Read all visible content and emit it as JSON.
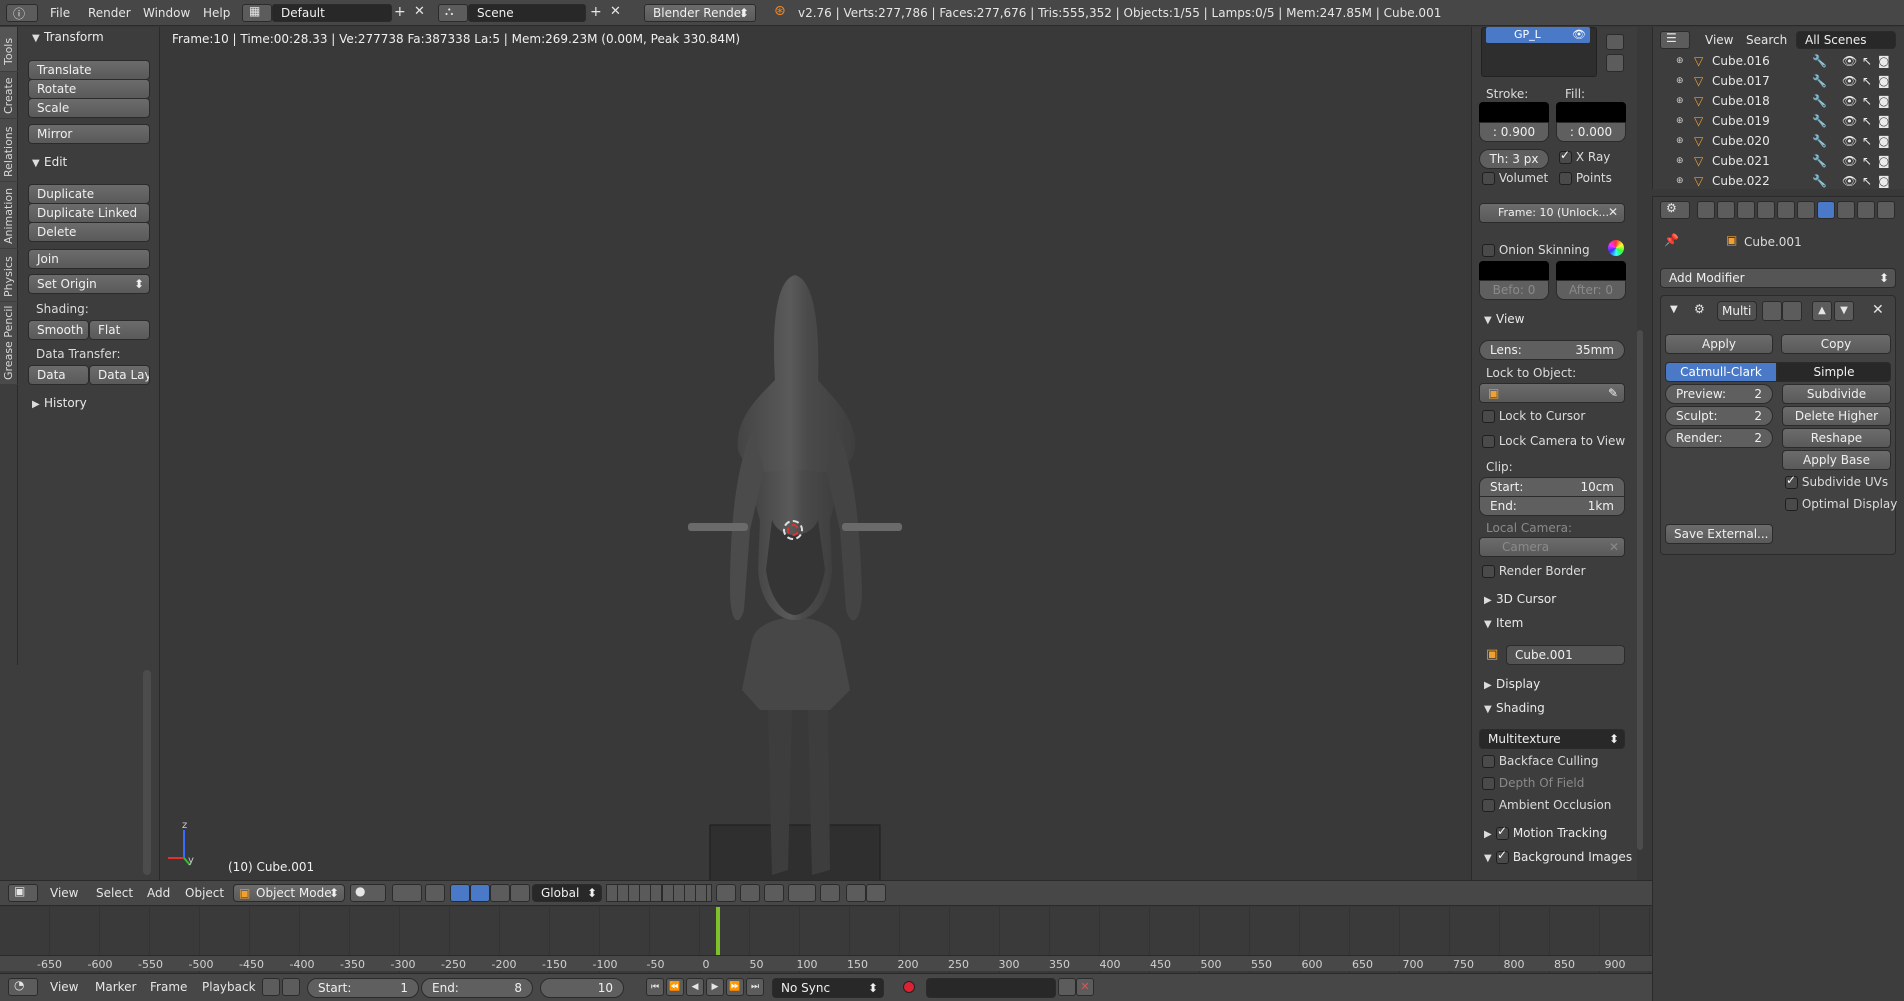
{
  "topbar": {
    "menus": [
      "File",
      "Render",
      "Window",
      "Help"
    ],
    "layout": "Default",
    "scene": "Scene",
    "engine": "Blender Render",
    "stats": "v2.76 | Verts:277,786 | Faces:277,676 | Tris:555,352 | Objects:1/55 | Lamps:0/5 | Mem:247.85M | Cube.001"
  },
  "tool_tabs": [
    "Tools",
    "Create",
    "Relations",
    "Animation",
    "Physics",
    "Grease Pencil"
  ],
  "tools": {
    "transform_header": "Transform",
    "transform": [
      "Translate",
      "Rotate",
      "Scale"
    ],
    "mirror": "Mirror",
    "edit_header": "Edit",
    "edit": [
      "Duplicate",
      "Duplicate Linked",
      "Delete"
    ],
    "join": "Join",
    "set_origin": "Set Origin",
    "shading_label": "Shading:",
    "smooth": "Smooth",
    "flat": "Flat",
    "data_transfer_label": "Data Transfer:",
    "data": "Data",
    "data_layout": "Data Layo",
    "history_header": "History"
  },
  "viewport": {
    "info": "Frame:10 | Time:00:28.33 | Ve:277738 Fa:387338 La:5 | Mem:269.23M (0.00M, Peak 330.84M)",
    "object_label": "(10) Cube.001",
    "axis_z": "z",
    "axis_y": "y"
  },
  "properties_panel": {
    "layer": "GP_L",
    "stroke_label": "Stroke:",
    "fill_label": "Fill:",
    "stroke_value": ": 0.900",
    "fill_value": ": 0.000",
    "thickness": "Th: 3 px",
    "xray": "X Ray",
    "volumetric": "Volumet",
    "points": "Points",
    "frame": "Frame: 10 (Unlock...",
    "onion": "Onion Skinning",
    "before": "Befo: 0",
    "after": "After: 0",
    "view_header": "View",
    "lens_label": "Lens:",
    "lens_value": "35mm",
    "lock_object": "Lock to Object:",
    "lock_cursor": "Lock to Cursor",
    "lock_camera": "Lock Camera to View",
    "clip_label": "Clip:",
    "clip_start_label": "Start:",
    "clip_start": "10cm",
    "clip_end_label": "End:",
    "clip_end": "1km",
    "local_camera": "Local Camera:",
    "camera": "Camera",
    "render_border": "Render Border",
    "cursor_header": "3D Cursor",
    "item_header": "Item",
    "item_name": "Cube.001",
    "display_header": "Display",
    "shading_header": "Shading",
    "shading_mode": "Multitexture",
    "backface": "Backface Culling",
    "dof": "Depth Of Field",
    "ao": "Ambient Occlusion",
    "motion_tracking": "Motion Tracking",
    "bg_images": "Background Images"
  },
  "outliner": {
    "menus": [
      "View",
      "Search"
    ],
    "scope": "All Scenes",
    "items": [
      "Cube.016",
      "Cube.017",
      "Cube.018",
      "Cube.019",
      "Cube.020",
      "Cube.021",
      "Cube.022"
    ]
  },
  "modifiers": {
    "object": "Cube.001",
    "add_modifier": "Add Modifier",
    "modifier_name": "Multi",
    "apply": "Apply",
    "copy": "Copy",
    "catmull": "Catmull-Clark",
    "simple": "Simple",
    "preview_label": "Preview:",
    "preview": "2",
    "sculpt_label": "Sculpt:",
    "sculpt": "2",
    "render_label": "Render:",
    "render": "2",
    "subdivide": "Subdivide",
    "delete_higher": "Delete Higher",
    "reshape": "Reshape",
    "apply_base": "Apply Base",
    "subdivide_uvs": "Subdivide UVs",
    "optimal_display": "Optimal Display",
    "save_external": "Save External..."
  },
  "view3d_header": {
    "menus": [
      "View",
      "Select",
      "Add",
      "Object"
    ],
    "mode": "Object Mode",
    "orientation": "Global"
  },
  "timeline": {
    "ticks": [
      "-650",
      "-600",
      "-550",
      "-500",
      "-450",
      "-400",
      "-350",
      "-300",
      "-250",
      "-200",
      "-150",
      "-100",
      "-50",
      "0",
      "50",
      "100",
      "150",
      "200",
      "250",
      "300",
      "350",
      "400",
      "450",
      "500",
      "550",
      "600",
      "650",
      "700",
      "750",
      "800",
      "850",
      "900"
    ],
    "current_frame": 10,
    "menus": [
      "View",
      "Marker",
      "Frame",
      "Playback"
    ],
    "start_label": "Start:",
    "start": "1",
    "end_label": "End:",
    "end": "8",
    "frame": "10",
    "sync": "No Sync"
  },
  "colors": {
    "accent": "#4a79c8",
    "playhead": "#7ec12a"
  }
}
